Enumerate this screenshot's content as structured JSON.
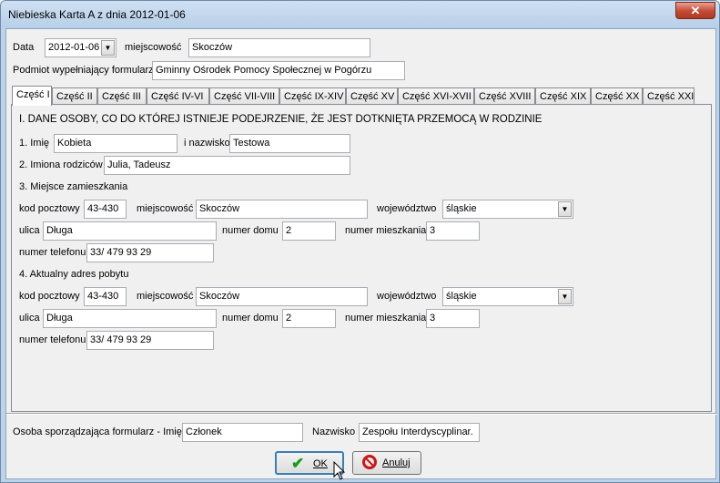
{
  "window": {
    "title": "Niebieska Karta A z dnia 2012-01-06",
    "close": "✕"
  },
  "header": {
    "date_label": "Data",
    "date_value": "2012-01-06",
    "place_label": "miejscowość",
    "place_value": "Skoczów",
    "entity_label": "Podmiot wypełniający formularz",
    "entity_value": "Gminny Ośrodek Pomocy Społecznej w Pogórzu"
  },
  "tabs": [
    "Część I",
    "Część II",
    "Część III",
    "Część IV-VI",
    "Część VII-VIII",
    "Część IX-XIV",
    "Część XV",
    "Część XVI-XVII",
    "Część XVIII",
    "Część XIX",
    "Część XX",
    "Część XXI"
  ],
  "section": {
    "heading": "I. DANE OSOBY, CO DO KTÓREJ ISTNIEJE PODEJRZENIE, ŻE JEST DOTKNIĘTA PRZEMOCĄ W RODZINIE",
    "name_label": "1. Imię",
    "name_value": "Kobieta",
    "surname_label": "i nazwisko",
    "surname_value": "Testowa",
    "parents_label": "2. Imiona rodziców",
    "parents_value": "Julia, Tadeusz",
    "residence_heading": "3. Miejsce zamieszkania",
    "current_heading": "4. Aktualny adres pobytu"
  },
  "address_labels": {
    "postal": "kod pocztowy",
    "city": "miejscowość",
    "province": "województwo",
    "street": "ulica",
    "house": "numer domu",
    "flat": "numer mieszkania",
    "phone": "numer telefonu"
  },
  "residence": {
    "postal": "43-430",
    "city": "Skoczów",
    "province": "śląskie",
    "street": "Długa",
    "house": "2",
    "flat": "3",
    "phone": "33/ 479 93 29"
  },
  "current": {
    "postal": "43-430",
    "city": "Skoczów",
    "province": "śląskie",
    "street": "Długa",
    "house": "2",
    "flat": "3",
    "phone": "33/ 479 93 29"
  },
  "footer": {
    "author_name_label": "Osoba sporządzająca formularz - Imię",
    "author_name_value": "Członek",
    "author_surname_label": "Nazwisko",
    "author_surname_value": "Zespołu Interdyscyplinar.",
    "ok_label": "OK",
    "cancel_label": "Anuluj"
  },
  "icons": {
    "ok": "check-icon",
    "cancel": "no-entry-icon",
    "dropdown": "chevron-down-icon"
  },
  "colors": {
    "ok_icon": "#1c9b1c",
    "cancel_icon": "#c81818",
    "close_button": "#c24a34"
  }
}
